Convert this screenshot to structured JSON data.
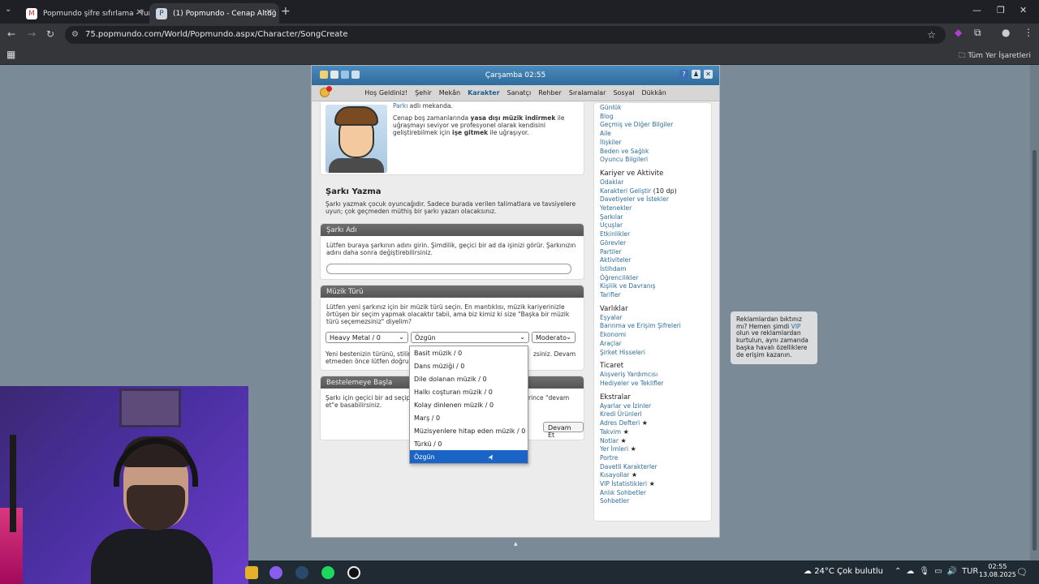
{
  "browser": {
    "tabs": [
      {
        "title": "Popmundo şifre sıfırlama - furic",
        "icon": "gmail-icon"
      },
      {
        "title": "(1) Popmundo - Cenap Altuğ",
        "icon": "popmundo-icon"
      }
    ],
    "url": "75.popmundo.com/World/Popmundo.aspx/Character/SongCreate",
    "bookmarks_all": "Tüm Yer İşaretleri"
  },
  "game": {
    "clock": "Çarşamba 02:55",
    "menu": [
      "Hoş Geldiniz!",
      "Şehir",
      "Mekân",
      "Karakter",
      "Sanatçı",
      "Rehber",
      "Sıralamalar",
      "Sosyal",
      "Dükkân"
    ],
    "intro": {
      "top_link": "Parkı",
      "top_rest": " adlı mekanda.",
      "p1": "Cenap boş zamanlarında ",
      "b1": "yasa dışı müzik indirmek",
      "p2": " ile uğraşmayı seviyor ve profesyonel olarak kendisini geliştirebilmek için ",
      "b2": "işe gitmek",
      "p3": " ile uğraşıyor."
    },
    "song": {
      "title": "Şarkı Yazma",
      "desc": "Şarkı yazmak çocuk oyuncağıdır. Sadece burada verilen talimatlara ve tavsiyelere uyun; çok geçmeden müthiş bir şarkı yazarı olacaksınız.",
      "name_header": "Şarkı Adı",
      "name_desc": "Lütfen buraya şarkının adını girin. Şimdilik, geçici bir ad da işinizi görür. Şarkınızın adını daha sonra değiştirebilirsiniz.",
      "name_value": "",
      "genre_header": "Müzik Türü",
      "genre_desc": "Lütfen yeni şarkınız için bir müzik türü seçin. En mantıklısı, müzik kariyerinizle örtüşen bir seçim yapmak olacaktır tabii, ama biz kimiz ki size \"Başka bir müzik türü seçemezsiniz\" diyelim?",
      "genre_select": "Heavy Metal / 0",
      "subgenre_select": "Özgün",
      "tempo_select": "Moderato",
      "genre_note_a": "Yeni bestenizin türünü, stilin",
      "genre_note_b": "zsiniz. Devam",
      "genre_note_c": "etmeden önce lütfen doğru s",
      "start_header": "Bestelemeye Başla",
      "start_desc_a": "Şarkı için geçici bir ad seçip,",
      "start_desc_b": "rince \"devam",
      "start_desc_c": "et\"e basabilirsiniz.",
      "continue_btn": "Devam Et"
    },
    "dropdown_options": [
      "Basit müzik / 0",
      "Dans müziği / 0",
      "Dile dolanan müzik / 0",
      "Halkı coşturan müzik / 0",
      "Kolay dinlenen müzik / 0",
      "Marş / 0",
      "Müzisyenlere hitap eden müzik / 0",
      "Türkü / 0",
      "Özgün"
    ],
    "sidebar": {
      "group1": [
        "Günlük",
        "Blog",
        "Geçmiş ve Diğer Bilgiler",
        "Aile",
        "İlişkiler",
        "Beden ve Sağlık",
        "Oyuncu Bilgileri"
      ],
      "h_career": "Kariyer ve Aktivite",
      "career_first": "Odaklar",
      "career_dev": "Karakteri Geliştir",
      "career_dev_tail": " (10 dp)",
      "career": [
        "Davetiyeler ve İstekler",
        "Yetenekler",
        "Şarkılar",
        "Uçuşlar",
        "Etkinlikler",
        "Görevler",
        "Partiler",
        "Aktiviteler",
        "İstihdam",
        "Öğrencilikler",
        "Kişilik ve Davranış",
        "Tarifler"
      ],
      "h_items": "Varlıklar",
      "items": [
        "Eşyalar",
        "Barınma ve Erişim Şifreleri",
        "Ekonomi",
        "Araçlar",
        "Şirket Hisseleri"
      ],
      "h_trade": "Ticaret",
      "trade": [
        "Alışveriş Yardımcısı",
        "Hediyeler ve Teklifler"
      ],
      "h_extra": "Ekstralar",
      "extras": [
        {
          "label": "Ayarlar ve İzinler",
          "star": ""
        },
        {
          "label": "Kredi Ürünleri",
          "star": ""
        },
        {
          "label": "Adres Defteri",
          "star": " ★"
        },
        {
          "label": "Takvim",
          "star": " ★"
        },
        {
          "label": "Notlar",
          "star": " ★"
        },
        {
          "label": "Yer İmleri",
          "star": " ★"
        },
        {
          "label": "Portre",
          "star": ""
        },
        {
          "label": "Davetli Karakterler",
          "star": ""
        },
        {
          "label": "Kısayollar",
          "star": " ★"
        },
        {
          "label": "VIP İstatistikleri",
          "star": " ★"
        },
        {
          "label": "Anlık Sohbetler",
          "star": ""
        },
        {
          "label": "Sohbetler",
          "star": ""
        }
      ]
    },
    "vip_ad": {
      "a": "Reklamlardan bıktınız mı? Hemen şimdi ",
      "link": "VIP",
      "b": " olun ve reklamlardan kurtulun, aynı zamanda başka havalı özelliklere de erişim kazanın."
    }
  },
  "taskbar": {
    "temp": "24°C",
    "weather": "Çok bulutlu",
    "lang": "TUR",
    "time": "02:55",
    "date": "13.08.2025"
  }
}
